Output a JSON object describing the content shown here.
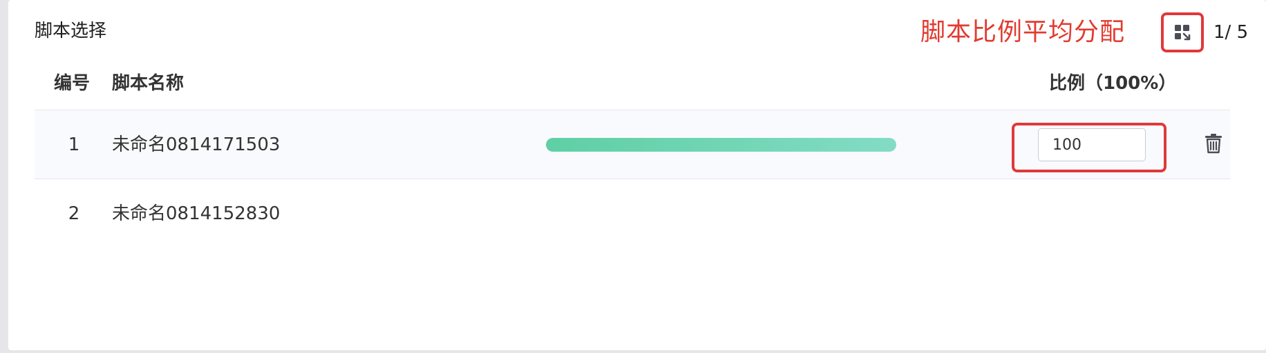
{
  "panel": {
    "title": "脚本选择"
  },
  "annotation": {
    "text": "脚本比例平均分配",
    "color": "#e23b2f"
  },
  "toolbar": {
    "distribute_icon": "distribute-evenly-icon",
    "pager": "1/ 5"
  },
  "table": {
    "headers": {
      "num": "编号",
      "name": "脚本名称",
      "ratio": "比例（100%）"
    },
    "rows": [
      {
        "num": "1",
        "name": "未命名0814171503",
        "ratio_value": "100",
        "ratio_fill": 1.0,
        "delete_icon": "trash-icon"
      },
      {
        "num": "2",
        "name": "未命名0814152830"
      }
    ]
  },
  "colors": {
    "highlight_border": "#e0393a",
    "progress_start": "#5fcfa5",
    "progress_end": "#82dcc4"
  }
}
